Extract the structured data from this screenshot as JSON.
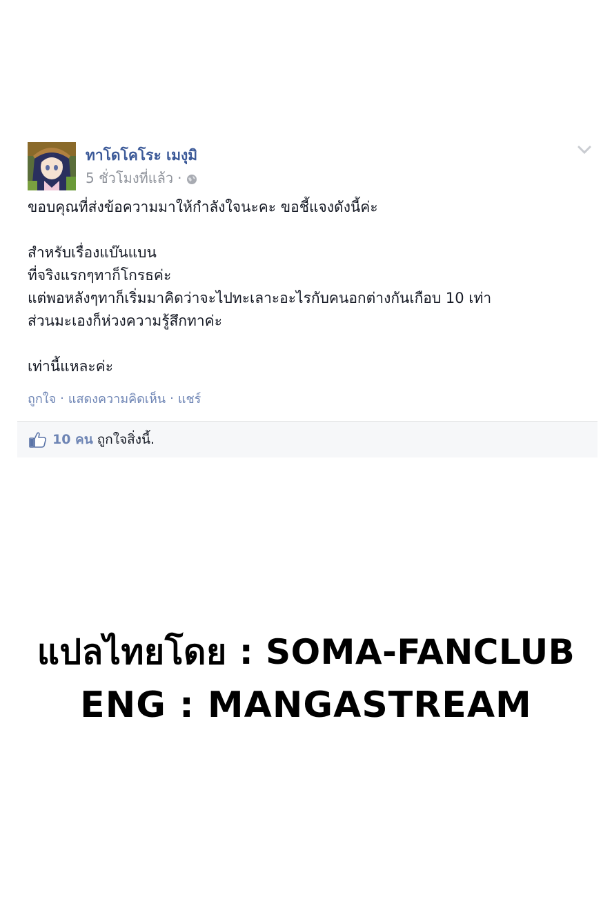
{
  "post": {
    "author": "ทาโดโคโระ เมงุมิ",
    "time": "5 ชั่วโมงที่แล้ว",
    "meta_separator": "·",
    "body_lines": {
      "l1": "ขอบคุณที่ส่งข้อความมาให้กำลังใจนะคะ ขอชี้แจงดังนี้ค่ะ",
      "l2": "สำหรับเรื่องแบ๊นแบน",
      "l3": "ที่จริงแรกๆทาก็โกรธค่ะ",
      "l4": "แต่พอหลังๆทาก็เริ่มมาคิดว่าจะไปทะเลาะอะไรกับคนอกต่างกันเกือบ 10 เท่า",
      "l5": "ส่วนมะเองก็ห่วงความรู้สึกทาค่ะ",
      "l6": "เท่านี้แหละค่ะ"
    },
    "actions": {
      "like": "ถูกใจ",
      "comment": "แสดงความคิดเห็น",
      "share": "แชร์",
      "separator": "·"
    },
    "likes": {
      "count": "10 คน",
      "text": "ถูกใจสิ่งนี้."
    }
  },
  "credits": {
    "line1": "แปลไทยโดย : SOMA-FANCLUB",
    "line2": "ENG : MANGASTREAM"
  },
  "colors": {
    "link": "#3b5998",
    "muted": "#90949c",
    "bar_bg": "#f6f7f9"
  }
}
